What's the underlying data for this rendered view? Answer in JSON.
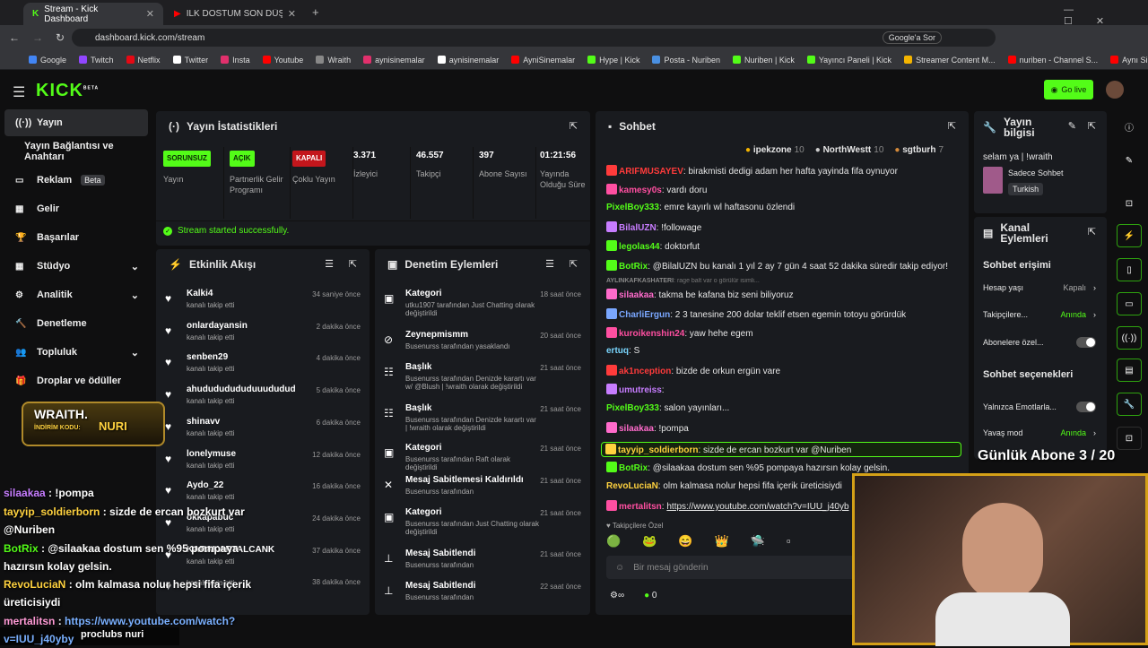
{
  "browser": {
    "tabs": [
      {
        "label": "Stream - Kick Dashboard"
      },
      {
        "label": "İLK DOSTUM SON DÜŞMANIM"
      }
    ],
    "url": "dashboard.kick.com/stream",
    "google_button": "Google'a Sor",
    "bookmarks": [
      "Google",
      "Twitch",
      "Netflix",
      "Twitter",
      "Insta",
      "Youtube",
      "Wraith",
      "aynisinemalar",
      "aynisinemalar",
      "AyniSinemalar",
      "Hype | Kick",
      "Posta - Nuriben",
      "Nuriben | Kick",
      "Yayıncı Paneli | Kick",
      "Streamer Content M...",
      "nuriben - Channel S...",
      "Aynı Sinemalar - Ça..."
    ]
  },
  "kick": {
    "logo": "KICK",
    "beta": "BETA",
    "go_live": "Go live"
  },
  "sidebar": {
    "items": [
      {
        "label": "Yayın"
      },
      {
        "label": "Yayın Bağlantısı ve Anahtarı"
      },
      {
        "label": "Reklam",
        "badge": "Beta"
      },
      {
        "label": "Gelir"
      },
      {
        "label": "Başarılar"
      },
      {
        "label": "Stüdyo"
      },
      {
        "label": "Analitik"
      },
      {
        "label": "Denetleme"
      },
      {
        "label": "Topluluk"
      },
      {
        "label": "Droplar ve ödüller"
      }
    ]
  },
  "stats": {
    "title": "Yayın İstatistikleri",
    "items": [
      {
        "tag": "SORUNSUZ",
        "label": "Yayın"
      },
      {
        "tag": "AÇIK",
        "label": "Partnerlik Gelir Programı"
      },
      {
        "tag": "KAPALI",
        "label": "Çoklu Yayın"
      },
      {
        "value": "3.371",
        "label": "İzleyici"
      },
      {
        "value": "46.557",
        "label": "Takipçi"
      },
      {
        "value": "397",
        "label": "Abone Sayısı"
      },
      {
        "value": "01:21:56",
        "label": "Yayında Olduğu Süre"
      }
    ],
    "status": "Stream started successfully."
  },
  "activity": {
    "title": "Etkinlik Akışı",
    "items": [
      {
        "name": "Kalki4",
        "sub": "kanalı takip etti",
        "time": "34 saniye önce"
      },
      {
        "name": "onlardayansin",
        "sub": "kanalı takip etti",
        "time": "2 dakika önce"
      },
      {
        "name": "senben29",
        "sub": "kanalı takip etti",
        "time": "4 dakika önce"
      },
      {
        "name": "ahudududududuuududud",
        "sub": "kanalı takip etti",
        "time": "5 dakika önce"
      },
      {
        "name": "shinavv",
        "sub": "kanalı takip etti",
        "time": "6 dakika önce"
      },
      {
        "name": "lonelymuse",
        "sub": "kanalı takip etti",
        "time": "12 dakika önce"
      },
      {
        "name": "Aydo_22",
        "sub": "kanalı takip etti",
        "time": "16 dakika önce"
      },
      {
        "name": "okkapabuc",
        "sub": "kanalı takip etti",
        "time": "24 dakika önce"
      },
      {
        "name": "KARAKARTALCANK",
        "sub": "kanalı takip etti",
        "time": "37 dakika önce"
      },
      {
        "name": "",
        "sub": "kanalı takip etti",
        "time": "38 dakika önce"
      }
    ]
  },
  "moderation": {
    "title": "Denetim Eylemleri",
    "items": [
      {
        "name": "Kategori",
        "sub": "utku1907 tarafından Just Chatting olarak değiştirildi",
        "time": "18 saat önce",
        "icon": "▣"
      },
      {
        "name": "Zeynepmismm",
        "sub": "Busenurss tarafından yasaklandı",
        "time": "20 saat önce",
        "icon": "⊘"
      },
      {
        "name": "Başlık",
        "sub": "Busenurss tarafından Denizde karartı var w/ @Blush | !wraith olarak değiştirildi",
        "time": "21 saat önce",
        "icon": "☷"
      },
      {
        "name": "Başlık",
        "sub": "Busenurss tarafından Denizde karartı var | !wraith olarak değiştirildi",
        "time": "21 saat önce",
        "icon": "☷"
      },
      {
        "name": "Kategori",
        "sub": "Busenurss tarafından Raft olarak değiştirildi",
        "time": "21 saat önce",
        "icon": "▣"
      },
      {
        "name": "Mesaj Sabitlemesi Kaldırıldı",
        "sub": "Busenurss tarafından",
        "time": "21 saat önce",
        "icon": "✕"
      },
      {
        "name": "Kategori",
        "sub": "Busenurss tarafından Just Chatting olarak değiştirildi",
        "time": "21 saat önce",
        "icon": "▣"
      },
      {
        "name": "Mesaj Sabitlendi",
        "sub": "Busenurss tarafından",
        "time": "21 saat önce",
        "icon": "⊥"
      },
      {
        "name": "Mesaj Sabitlendi",
        "sub": "Busenurss tarafından",
        "time": "22 saat önce",
        "icon": "⊥"
      }
    ]
  },
  "chat": {
    "title": "Sohbet",
    "top": [
      {
        "name": "ipekzone",
        "n": "10"
      },
      {
        "name": "NorthWestt",
        "n": "10"
      },
      {
        "name": "sgtburh",
        "n": "7"
      }
    ],
    "messages": [
      {
        "user": "ARIFMUSAYEV",
        "text": "birakmisti dedigi adam her hafta yayinda fifa oynuyor",
        "color": "#ff3b3b"
      },
      {
        "user": "kamesy0s",
        "text": "vardı doru",
        "color": "#ff4fa1"
      },
      {
        "user": "PixelBoy333",
        "text": "emre kayırlı wl haftasonu özlendi",
        "color": "#53fc18"
      },
      {
        "user": "BilalUZN",
        "text": "!followage",
        "color": "#c77dff"
      },
      {
        "user": "legolas44",
        "text": "doktorfut",
        "color": "#53fc18"
      },
      {
        "user": "BotRix",
        "text": "@BilalUZN bu kanalı 1 yıl 2 ay 7 gün 4 saat 52 dakika süredir takip ediyor!",
        "color": "#53fc18"
      },
      {
        "user": "AYLINKAFKASHATERI",
        "text": "rage balt var o görülür isimli...",
        "color": "#888"
      },
      {
        "user": "silaakaa",
        "text": "takma be kafana biz seni biliyoruz",
        "color": "#ff6bcb"
      },
      {
        "user": "CharliErgun",
        "text": "2 3 tanesine 200 dolar teklif etsen egemin totoyu görürdük",
        "color": "#7aa7ff"
      },
      {
        "user": "kuroikenshin24",
        "text": "yaw hehe egem",
        "color": "#ff4fa1"
      },
      {
        "user": "ertuq",
        "text": "S",
        "color": "#7ad7ff"
      },
      {
        "user": "ak1nception",
        "text": "bizde de orkun ergün vare",
        "color": "#ff3b3b"
      },
      {
        "user": "umutreiss",
        "text": "",
        "color": "#c77dff"
      },
      {
        "user": "PixelBoy333",
        "text": "salon yayınları...",
        "color": "#53fc18"
      },
      {
        "user": "silaakaa",
        "text": "!pompa",
        "color": "#ff6bcb"
      },
      {
        "user": "tayyip_soldierborn",
        "text": "sizde de ercan bozkurt var @Nuriben",
        "color": "#ffd23f"
      },
      {
        "user": "BotRix",
        "text": "@silaakaa dostum sen %95 pompaya hazırsın kolay gelsin.",
        "color": "#53fc18"
      },
      {
        "user": "RevoLuciaN",
        "text": "olm kalmasa nolur hepsi fifa içerik üreticisiydi",
        "color": "#ffd23f"
      },
      {
        "user": "mertalitsn",
        "text": "https://www.youtube.com/watch?v=IUU_j40yb",
        "color": "#ff4fa1"
      }
    ],
    "emote_label": "Takipçilere Özel",
    "input_placeholder": "Bir mesaj gönderin",
    "points": "0"
  },
  "stream_info": {
    "title": "Yayın bilgisi",
    "stream_title": "selam ya | !wraith",
    "category": "Sadece Sohbet",
    "language": "Turkish"
  },
  "channel_actions": {
    "title": "Kanal Eylemleri",
    "chat_access": "Sohbet erişimi",
    "rows": [
      {
        "label": "Hesap yaşı",
        "value": "Kapalı"
      },
      {
        "label": "Takipçilere...",
        "value": "Anında"
      },
      {
        "label": "Abonelere özel...",
        "value": ""
      },
      {
        "label": "Yalnızca Emotlarla...",
        "value": ""
      },
      {
        "label": "Yavaş mod",
        "value": "Anında"
      }
    ],
    "chat_options": "Sohbet seçenekleri"
  },
  "overlay": {
    "sub_goal": "Günlük Abone 3 / 20",
    "promo_brand": "WRAITH.",
    "promo_code_label": "İNDİRİM KODU:",
    "promo_code": "NURI",
    "chat": [
      {
        "user": "silaakaa",
        "text": "!pompa"
      },
      {
        "user": "tayyip_soldierborn",
        "text": "sizde de ercan bozkurt var @Nuriben"
      },
      {
        "user": "BotRix",
        "text": "@silaakaa dostum sen %95 pompaya hazırsın kolay gelsin."
      },
      {
        "user": "RevoLuciaN",
        "text": "olm kalmasa nolur hepsi fifa içerik üreticisiydi"
      },
      {
        "user": "mertalitsn",
        "text": "https://www.youtube.com/watch?v=IUU_j40yby"
      }
    ],
    "footer": "proclubs nuri"
  }
}
